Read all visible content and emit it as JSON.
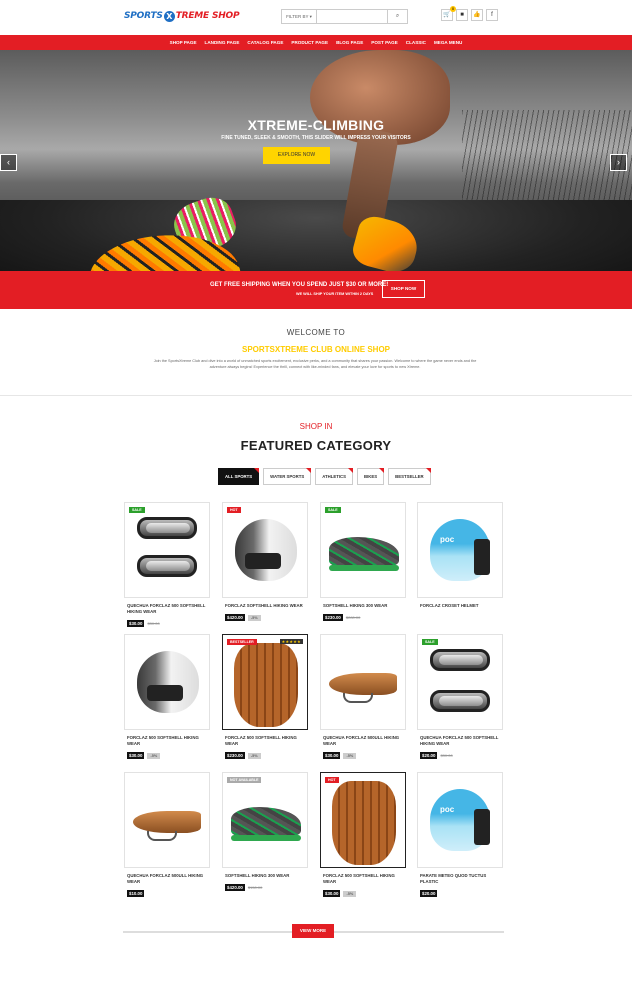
{
  "header": {
    "logo_part1": "SPORTS",
    "logo_x": "X",
    "logo_part2": "TREME SHOP",
    "filter_label": "FILTER BY",
    "search_placeholder": "",
    "cart_count": "0"
  },
  "nav": [
    "SHOP PAGE",
    "LANDING PAGE",
    "CATALOG PAGE",
    "PRODUCT PAGE",
    "BLOG PAGE",
    "POST PAGE",
    "CLASSIC",
    "MEGA MENU"
  ],
  "hero": {
    "title": "XTREME-CLIMBING",
    "subtitle": "FINE TUNED, SLEEK & SMOOTH, THIS SLIDER WILL IMPRESS YOUR VISITORS",
    "button": "EXPLORE NOW"
  },
  "shipping": {
    "line1": "GET FREE SHIPPING WHEN YOU SPEND JUST $30 OR MORE!",
    "line2": "WE WILL SHIP YOUR ITEM WITHIN 2 DAYS",
    "button": "SHOP NOW"
  },
  "welcome": {
    "title": "WELCOME TO",
    "subtitle": "SPORTSXTREME CLUB ONLINE SHOP",
    "description": "Join the SportsXtreme Club and dive into a world of unmatched sports excitement, exclusive perks, and a community that shares your passion. Welcome to where the game never ends and the adventure always begins! Experience the thrill, connect with like-minded fans, and elevate your love for sports to new Xtreme."
  },
  "shop": {
    "eyebrow": "SHOP IN",
    "title": "FEATURED CATEGORY",
    "tabs": [
      "ALL SPORTS",
      "WATER SPORTS",
      "ATHLETICS",
      "BIKES",
      "BESTSELLER"
    ]
  },
  "products": [
    {
      "name": "QUECHUA FORCLAZ 500 SOFTSHELL HIKING WEAR",
      "price": "$30.00",
      "old_price": "$30.00",
      "badge": "SALE",
      "discount": ""
    },
    {
      "name": "FORCLAZ SOFTSHELL HIKING WEAR",
      "price": "$420.00",
      "old_price": "",
      "badge": "HOT",
      "discount": "-5%"
    },
    {
      "name": "SOFTSHELL HIKING 300 WEAR",
      "price": "$230.00",
      "old_price": "$280.00",
      "badge": "SALE",
      "discount": ""
    },
    {
      "name": "FORCLAZ CROSET HELMET",
      "price": "",
      "old_price": "",
      "badge": "",
      "discount": ""
    },
    {
      "name": "FORCLAZ 500 SOFTSHELL HIKING WEAR",
      "price": "$30.00",
      "old_price": "",
      "badge": "",
      "discount": "-5%"
    },
    {
      "name": "FORCLAZ 500 SOFTSHELL HIKING WEAR",
      "price": "$230.00",
      "old_price": "",
      "badge": "BESTSELLER",
      "discount": "-5%",
      "stars": "★★★★★"
    },
    {
      "name": "QUECHUA FORCLAZ 500ULL HIKING WEAR",
      "price": "$30.00",
      "old_price": "",
      "badge": "",
      "discount": "-5%"
    },
    {
      "name": "QUECHUA FORCLAZ 500 SOFTSHELL HIKING WEAR",
      "price": "$20.00",
      "old_price": "$30.00",
      "badge": "SALE",
      "discount": ""
    },
    {
      "name": "QUECHUA FORCLAZ 500ULL HIKING WEAR",
      "price": "$10.00",
      "old_price": "",
      "badge": "",
      "discount": ""
    },
    {
      "name": "SOFTSHELL HIKING 300 WEAR",
      "price": "$420.00",
      "old_price": "$150.00",
      "badge": "NOT AVAILABLE",
      "discount": ""
    },
    {
      "name": "FORCLAZ 500 SOFTSHELL HIKING WEAR",
      "price": "$30.00",
      "old_price": "",
      "badge": "HOT",
      "discount": "-5%"
    },
    {
      "name": "PARATE METEO QUOD TUCTUS PLASTIC",
      "price": "$20.00",
      "old_price": "",
      "badge": "",
      "discount": ""
    }
  ],
  "view_more": "VIEW MORE",
  "colors": {
    "accent": "#e31e24",
    "yellow": "#ffd400",
    "brand_blue": "#1f6fc4"
  }
}
